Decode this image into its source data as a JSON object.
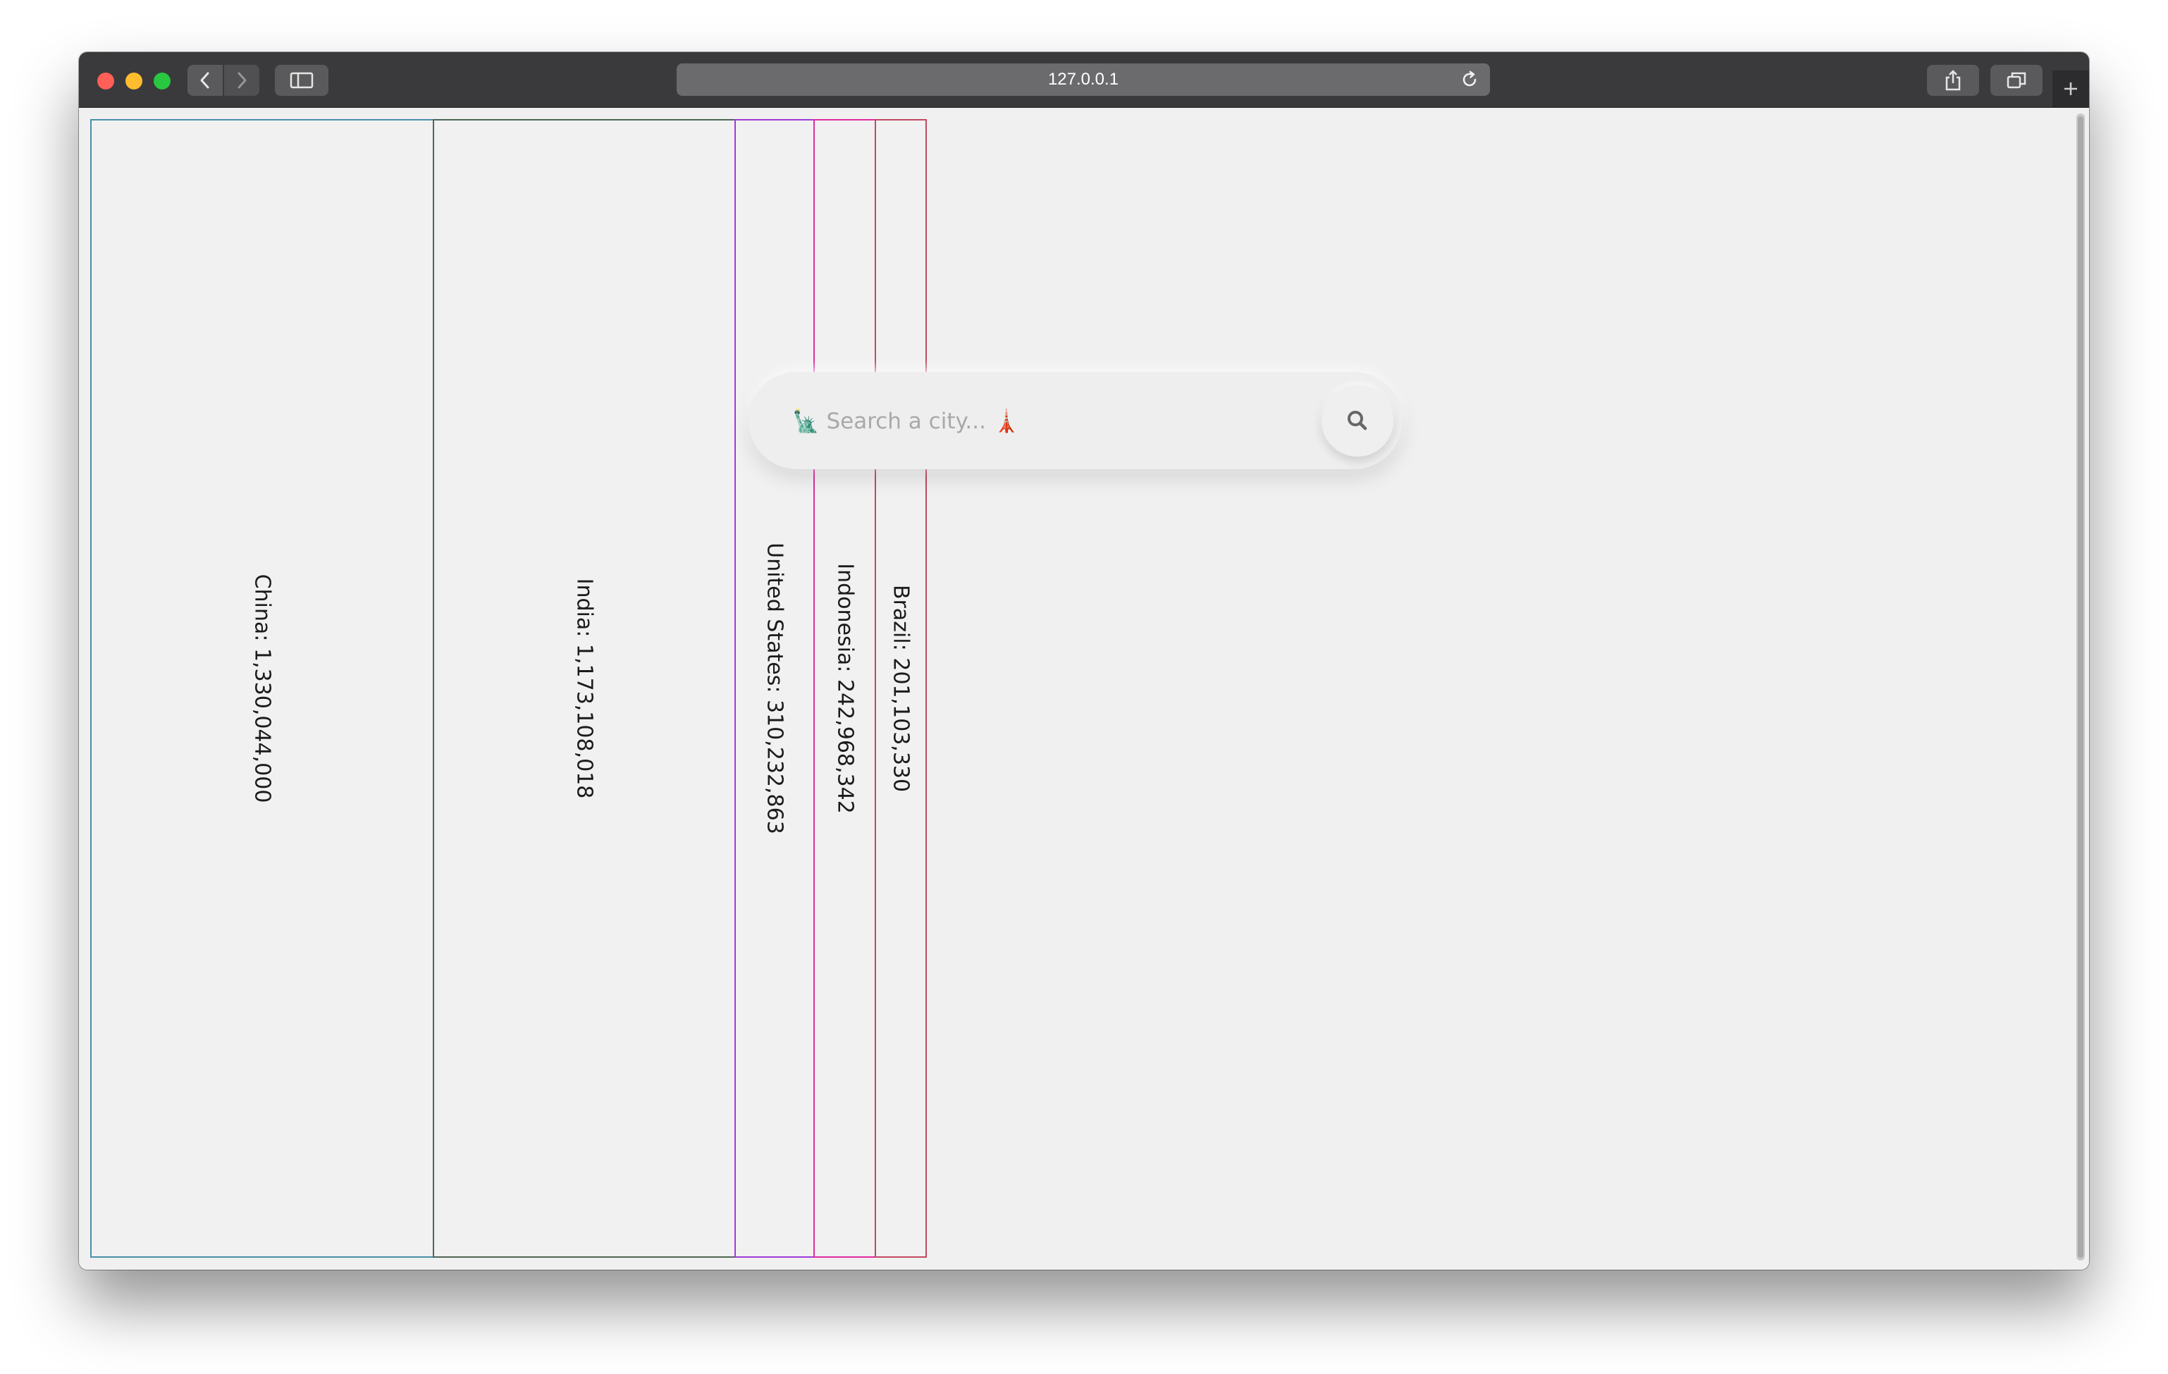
{
  "browser": {
    "address": "127.0.0.1",
    "icons": {
      "back": "chevron-left-icon",
      "forward": "chevron-right-icon",
      "sidebar": "sidebar-icon",
      "reload": "reload-icon",
      "share": "share-icon",
      "tabs": "tabs-icon",
      "new_tab": "plus-icon"
    }
  },
  "search": {
    "placeholder": "🗽 Search a city... 🗼",
    "button_icon": "search-icon"
  },
  "chart_data": {
    "type": "bar",
    "orientation": "vertical-stacked-horizontally",
    "categories": [
      "China",
      "India",
      "United States",
      "Indonesia",
      "Brazil"
    ],
    "values": [
      1330044000,
      1173108018,
      310232863,
      242968342,
      201103330
    ],
    "labels": [
      "China: 1,330,044,000",
      "India: 1,173,108,018",
      "United States: 310,232,863",
      "Indonesia: 242,968,342",
      "Brazil: 201,103,330"
    ],
    "colors": [
      "#3b8a9e",
      "#3e5a4a",
      "#9d35d6",
      "#d6289c",
      "#b83a5a",
      "#6e9e58"
    ],
    "border_colors": [
      "#4a8fa8",
      "#4f6654",
      "#a03ad8",
      "#e02ba0",
      "#c04a62",
      "#7aa860"
    ]
  }
}
